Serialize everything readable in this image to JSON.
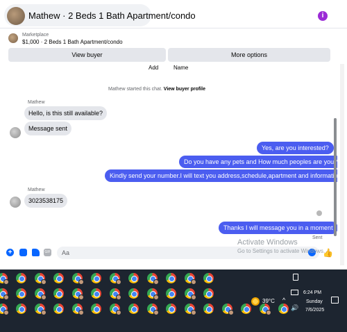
{
  "header": {
    "title": "Mathew · 2 Beds 1 Bath Apartment/condo",
    "menu_icon": "more-options-icon",
    "menu_glyph": "i"
  },
  "marketplace": {
    "label": "Marketplace",
    "price_title": "$1,000 · 2 Beds 1 Bath Apartment/condo",
    "view_buyer_label": "View buyer",
    "more_options_label": "More options"
  },
  "chat": {
    "partial_row": {
      "add": "Add",
      "name": "Name"
    },
    "started_prefix": "Mathew started this chat.",
    "started_link": "View buyer profile",
    "groups": [
      {
        "sender": "Mathew",
        "messages": [
          "Hello, is this still available?",
          "Message sent"
        ]
      },
      {
        "sender": "Mathew",
        "messages": [
          "3023538175"
        ]
      }
    ],
    "outgoing_block1": [
      "Yes, are you interested?",
      "Do you have any pets and How much peoples are you?",
      "Kindly send your number.I will text you address,schedule,apartment and information."
    ],
    "outgoing_block2": [
      "Thanks I will message you in a moment"
    ],
    "status": "Sent"
  },
  "composer": {
    "placeholder": "Aa",
    "plus_glyph": "+",
    "gif_label": "GIF",
    "like_glyph": "👍"
  },
  "watermark": {
    "title": "Activate Windows",
    "subtitle": "Go to Settings to activate Windows."
  },
  "taskbar": {
    "weather": "39°C",
    "chevron": "^",
    "volume_glyph": "🔊",
    "time": "6:24 PM",
    "day": "Sunday",
    "date": "7/6/2025",
    "app_count": 40
  },
  "colors": {
    "outgoing_bubble": "#4b5df0",
    "incoming_bubble": "#e4e6eb",
    "accent": "#0866ff",
    "taskbar": "#1d2530"
  }
}
